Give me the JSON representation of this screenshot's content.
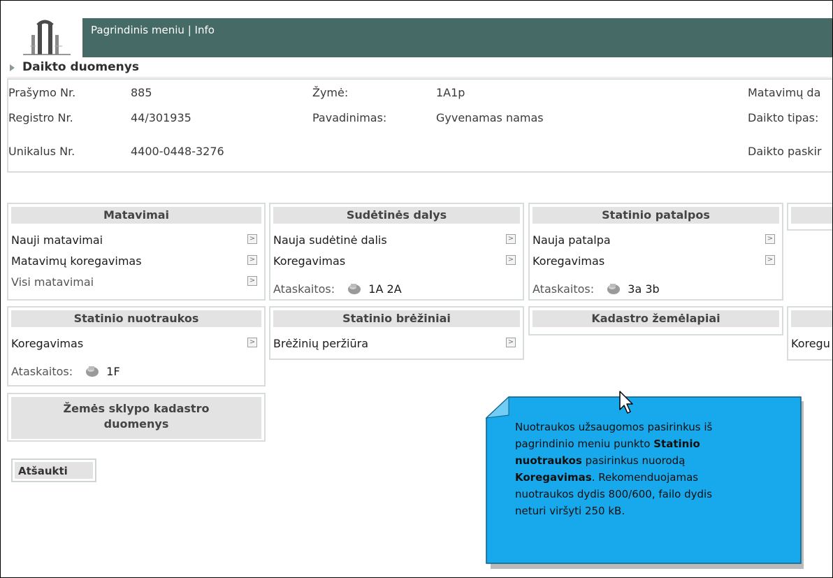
{
  "menu": {
    "main": "Pagrindinis meniu",
    "sep": "|",
    "info": "Info"
  },
  "section_title": "Daikto duomenys",
  "fields": {
    "prasymo_label": "Prašymo Nr.",
    "prasymo_value": "885",
    "registro_label": "Registro Nr.",
    "registro_value": "44/301935",
    "unikalus_label": "Unikalus Nr.",
    "unikalus_value": "4400-0448-3276",
    "zyme_label": "Žymė:",
    "zyme_value": "1A1p",
    "pavadinimas_label": "Pavadinimas:",
    "pavadinimas_value": "Gyvenamas namas",
    "matavimu_label": "Matavimų da",
    "daikto_tipas_label": "Daikto tipas:",
    "daikto_paskirtis_label": "Daikto paskir"
  },
  "panels": {
    "matavimai": {
      "title": "Matavimai",
      "items": [
        "Nauji matavimai",
        "Matavimų koregavimas",
        "Visi matavimai"
      ]
    },
    "sudetines": {
      "title": "Sudėtinės dalys",
      "items": [
        "Nauja sudėtinė dalis",
        "Koregavimas"
      ],
      "reports_label": "Ataskaitos:",
      "reports": "1A 2A"
    },
    "patalpos": {
      "title": "Statinio patalpos",
      "items": [
        "Nauja patalpa",
        "Koregavimas"
      ],
      "reports_label": "Ataskaitos:",
      "reports": "3a 3b"
    },
    "nuotraukos": {
      "title": "Statinio nuotraukos",
      "items": [
        "Koregavimas"
      ],
      "reports_label": "Ataskaitos:",
      "reports": "1F"
    },
    "breziniai": {
      "title": "Statinio brėžiniai",
      "items": [
        "Brėžinių peržiūra"
      ]
    },
    "kadastro": {
      "title": "Kadastro žemėlapiai"
    },
    "right_partial": {
      "item": "Koregu"
    },
    "sklypo": {
      "title_line1": "Žemės sklypo kadastro",
      "title_line2": "duomenys"
    }
  },
  "cancel_button": "Atšaukti",
  "tooltip": {
    "t1": "Nuotraukos užsaugomos pasirinkus iš",
    "t2": "pagrindinio meniu punkto ",
    "b1": "Statinio",
    "b2": "nuotraukos",
    "t3": " pasirinkus nuorodą",
    "b3": "Koregavimas",
    "t4": ". Rekomenduojamas",
    "t5": "nuotraukos dydis 800/600, failo dydis",
    "t6": "neturi viršyti 250 kB."
  },
  "colors": {
    "menubar": "#466b67",
    "panel_header": "#e3e3e3",
    "panel_border": "#d7dddd",
    "tooltip": "#18a9ec"
  }
}
